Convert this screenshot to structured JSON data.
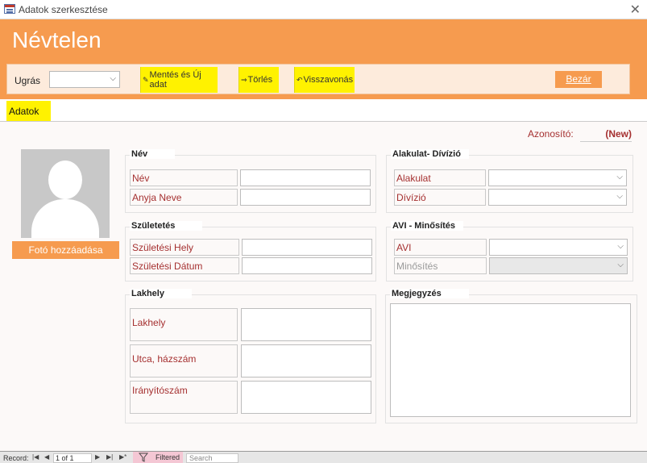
{
  "window": {
    "title": "Adatok szerkesztése",
    "close_glyph": "✕"
  },
  "header": {
    "title": "Névtelen"
  },
  "toolbar": {
    "goto_label": "Ugrás",
    "goto_value": "",
    "save_new_label": "Mentés és Új adat",
    "delete_label": "Törlés",
    "undo_label": "Visszavonás",
    "close_label": "Bezár"
  },
  "tab": {
    "label": "Adatok"
  },
  "record_id": {
    "label": "Azonosító:",
    "value": "(New)"
  },
  "photo": {
    "button_label": "Fotó hozzáadása"
  },
  "groups": {
    "name": {
      "title": "Név",
      "field1": "Név",
      "field2": "Anyja Neve"
    },
    "birth": {
      "title": "Születetés",
      "field1": "Születési Hely",
      "field2": "Születési Dátum"
    },
    "residence": {
      "title": "Lakhely",
      "field1": "Lakhely",
      "field2": "Utca, házszám",
      "field3": "Irányítószám"
    },
    "unit": {
      "title": "Alakulat- Dívízió",
      "field1": "Alakulat",
      "field2": "Dívízió"
    },
    "avi": {
      "title": "AVI - Minősítés",
      "field1": "AVI",
      "field2": "Minősítés"
    },
    "note": {
      "title": "Megjegyzés"
    }
  },
  "statusbar": {
    "record_label": "Record:",
    "position": "1 of 1",
    "filter_label": "Filtered",
    "search_placeholder": "Search"
  },
  "colors": {
    "accent": "#f69b4f",
    "highlight": "#fff200",
    "label_text": "#a53030"
  }
}
